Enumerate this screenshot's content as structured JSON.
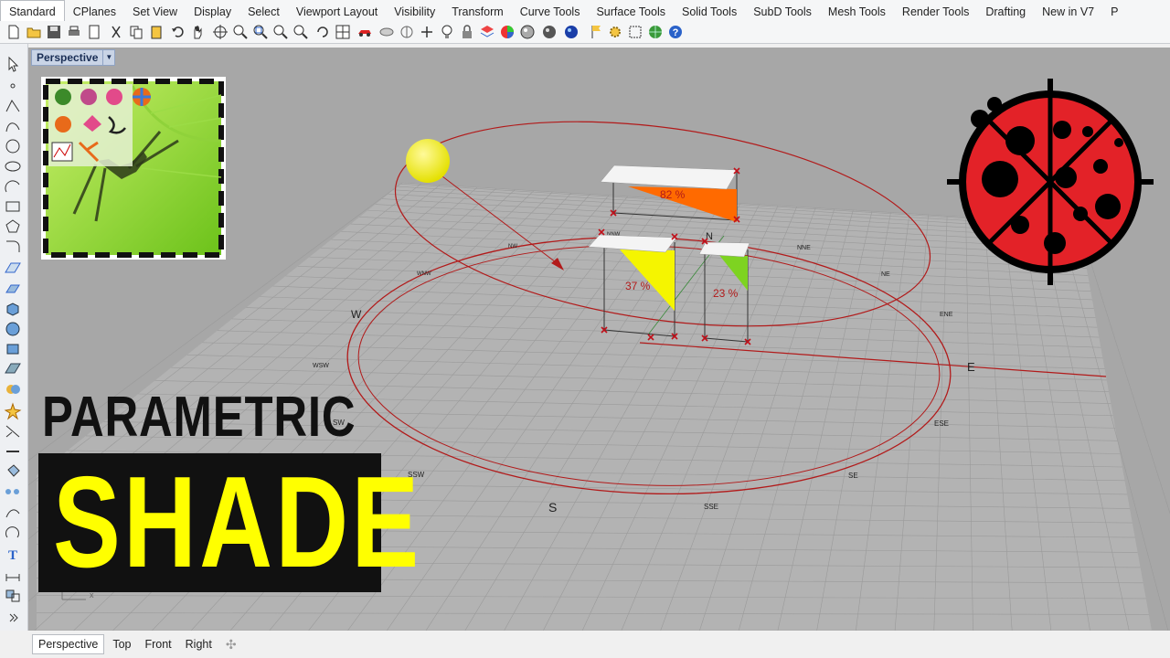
{
  "menu_tabs": [
    "Standard",
    "CPlanes",
    "Set View",
    "Display",
    "Select",
    "Viewport Layout",
    "Visibility",
    "Transform",
    "Curve Tools",
    "Surface Tools",
    "Solid Tools",
    "SubD Tools",
    "Mesh Tools",
    "Render Tools",
    "Drafting",
    "New in V7",
    "P"
  ],
  "active_tab": "Standard",
  "viewport": {
    "label": "Perspective",
    "dropdown_icon": "chevron-down-icon"
  },
  "compass": {
    "cardinals": [
      "N",
      "E",
      "S",
      "W"
    ],
    "intercardinals": [
      "NNE",
      "NE",
      "ENE",
      "ESE",
      "SE",
      "SSE",
      "SSW",
      "SW",
      "WSW",
      "WNW",
      "NW",
      "NNW"
    ]
  },
  "shade_results": [
    {
      "label": "82 %",
      "color": "#ff6a00"
    },
    {
      "label": "37 %",
      "color": "#f5f500"
    },
    {
      "label": "23 %",
      "color": "#7ed321"
    }
  ],
  "title": {
    "line1": "PARAMETRIC",
    "line2": "SHADE"
  },
  "bottom_tabs": [
    "Perspective",
    "Top",
    "Front",
    "Right"
  ],
  "active_bottom_tab": "Perspective",
  "axes_label": "x",
  "colors": {
    "viewport_bg": "#a7a7a7",
    "sun": "#f5f500",
    "sunpath": "#b21a1a",
    "accent_yellow": "#ffff00",
    "ladybug_red": "#e32228"
  }
}
